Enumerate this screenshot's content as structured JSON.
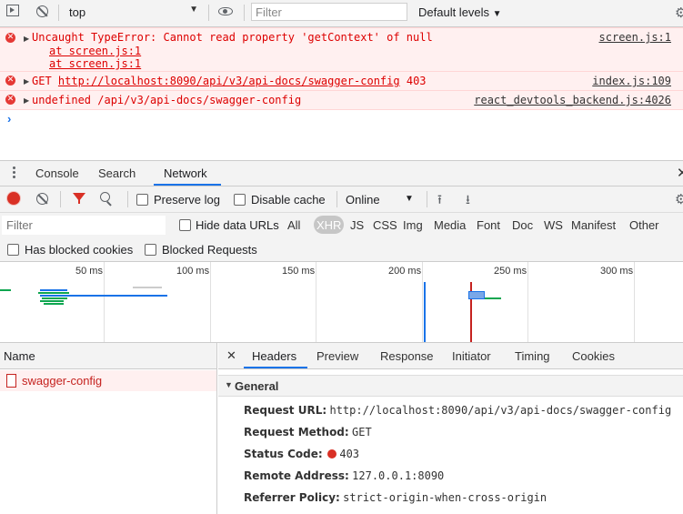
{
  "console_toolbar": {
    "context": "top",
    "filter_placeholder": "Filter",
    "levels": "Default levels"
  },
  "messages": [
    {
      "text": "Uncaught TypeError: Cannot read property 'getContext' of null",
      "source": "screen.js:1",
      "stack": [
        "at screen.js:1",
        "at screen.js:1"
      ]
    },
    {
      "method": "GET",
      "url": "http://localhost:8090/api/v3/api-docs/swagger-config",
      "status": "403",
      "source": "index.js:109"
    },
    {
      "text": "undefined /api/v3/api-docs/swagger-config",
      "source": "react_devtools_backend.js:4026"
    }
  ],
  "drawer_tabs": [
    "Console",
    "Search",
    "Network"
  ],
  "network_toolbar": {
    "preserve_log": "Preserve log",
    "disable_cache": "Disable cache",
    "throttle": "Online"
  },
  "filter_row": {
    "placeholder": "Filter",
    "hide_data_urls": "Hide data URLs",
    "types": [
      "All",
      "XHR",
      "JS",
      "CSS",
      "Img",
      "Media",
      "Font",
      "Doc",
      "WS",
      "Manifest",
      "Other"
    ],
    "selected_type": "XHR"
  },
  "blocked_row": {
    "has_blocked_cookies": "Has blocked cookies",
    "blocked_requests": "Blocked Requests"
  },
  "overview": {
    "ticks": [
      "50 ms",
      "100 ms",
      "150 ms",
      "200 ms",
      "250 ms",
      "300 ms"
    ]
  },
  "requests": {
    "header": "Name",
    "items": [
      "swagger-config"
    ]
  },
  "details": {
    "tabs": [
      "Headers",
      "Preview",
      "Response",
      "Initiator",
      "Timing",
      "Cookies"
    ],
    "section": "General",
    "request_url_label": "Request URL:",
    "request_url": "http://localhost:8090/api/v3/api-docs/swagger-config",
    "request_method_label": "Request Method:",
    "request_method": "GET",
    "status_code_label": "Status Code:",
    "status_code": "403",
    "remote_address_label": "Remote Address:",
    "remote_address": "127.0.0.1:8090",
    "referrer_policy_label": "Referrer Policy:",
    "referrer_policy": "strict-origin-when-cross-origin"
  },
  "colors": {
    "error": "#dd0000",
    "record": "#d93025",
    "accent": "#1a73e8"
  }
}
